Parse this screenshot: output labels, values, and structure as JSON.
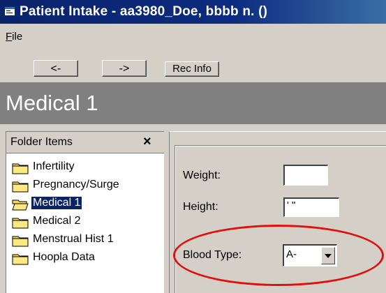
{
  "window": {
    "title": "Patient Intake - aa3980_Doe, bbbb n. ()"
  },
  "menu": {
    "file_label": "File",
    "file_mnemonic": "F",
    "file_rest": "ile"
  },
  "toolbar": {
    "back_label": "<-",
    "forward_label": "->",
    "rec_info_label": "Rec Info"
  },
  "section": {
    "title": "Medical 1"
  },
  "folder_panel": {
    "header": "Folder Items",
    "close_glyph": "×",
    "items": [
      {
        "label": "Infertility"
      },
      {
        "label": "Pregnancy/Surge"
      },
      {
        "label": "Medical 1",
        "selected": true
      },
      {
        "label": "Medical 2"
      },
      {
        "label": "Menstrual Hist 1"
      },
      {
        "label": "Hoopla Data"
      }
    ]
  },
  "form": {
    "weight": {
      "label": "Weight:",
      "value": ""
    },
    "height": {
      "label": "Height:",
      "value": "' \""
    },
    "blood_type": {
      "label": "Blood Type:",
      "value": "A-"
    }
  },
  "colors": {
    "titlebar": "#0a246a",
    "section_header": "#808080",
    "highlight": "#e01010",
    "window_bg": "#d4d0c8"
  },
  "icons": {
    "app": "app-icon",
    "folder": "folder-icon",
    "close": "close-icon",
    "dropdown": "chevron-down-icon"
  }
}
